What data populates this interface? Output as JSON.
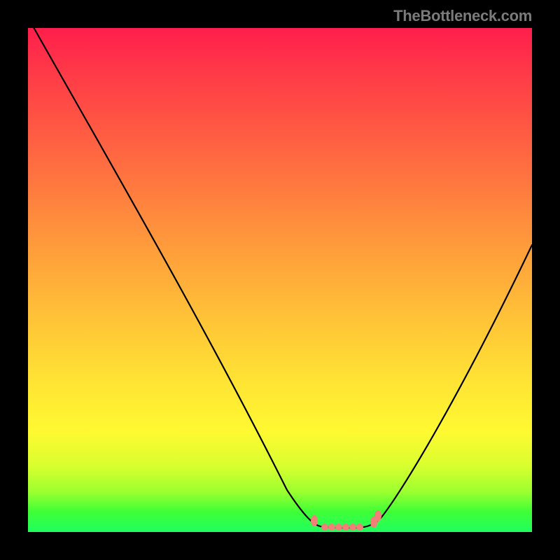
{
  "watermark": {
    "text": "TheBottleneck.com"
  },
  "chart_data": {
    "type": "line",
    "title": "",
    "xlabel": "",
    "ylabel": "",
    "xlim": [
      0,
      100
    ],
    "ylim": [
      0,
      100
    ],
    "x": [
      0,
      5,
      10,
      15,
      20,
      25,
      30,
      35,
      40,
      45,
      50,
      55,
      58,
      60,
      62,
      64,
      66,
      68,
      70,
      75,
      80,
      85,
      90,
      95,
      100
    ],
    "y": [
      102,
      95,
      87,
      79,
      71,
      63,
      55,
      46,
      37,
      27,
      17,
      6,
      2,
      1,
      1,
      1,
      1,
      1,
      2,
      8,
      17,
      27,
      37,
      47,
      57
    ],
    "highlight_marker": {
      "x_range": [
        57,
        70
      ],
      "color": "#f08078"
    },
    "background_gradient_stops": [
      {
        "offset": 0.0,
        "color": "#ff1e4c"
      },
      {
        "offset": 0.1,
        "color": "#ff3d47"
      },
      {
        "offset": 0.25,
        "color": "#ff6741"
      },
      {
        "offset": 0.4,
        "color": "#ff923c"
      },
      {
        "offset": 0.55,
        "color": "#ffbc38"
      },
      {
        "offset": 0.7,
        "color": "#ffe334"
      },
      {
        "offset": 0.8,
        "color": "#fff931"
      },
      {
        "offset": 0.87,
        "color": "#d8ff2f"
      },
      {
        "offset": 0.92,
        "color": "#9cff2f"
      },
      {
        "offset": 0.96,
        "color": "#3fff37"
      },
      {
        "offset": 1.0,
        "color": "#1fff5e"
      }
    ]
  }
}
